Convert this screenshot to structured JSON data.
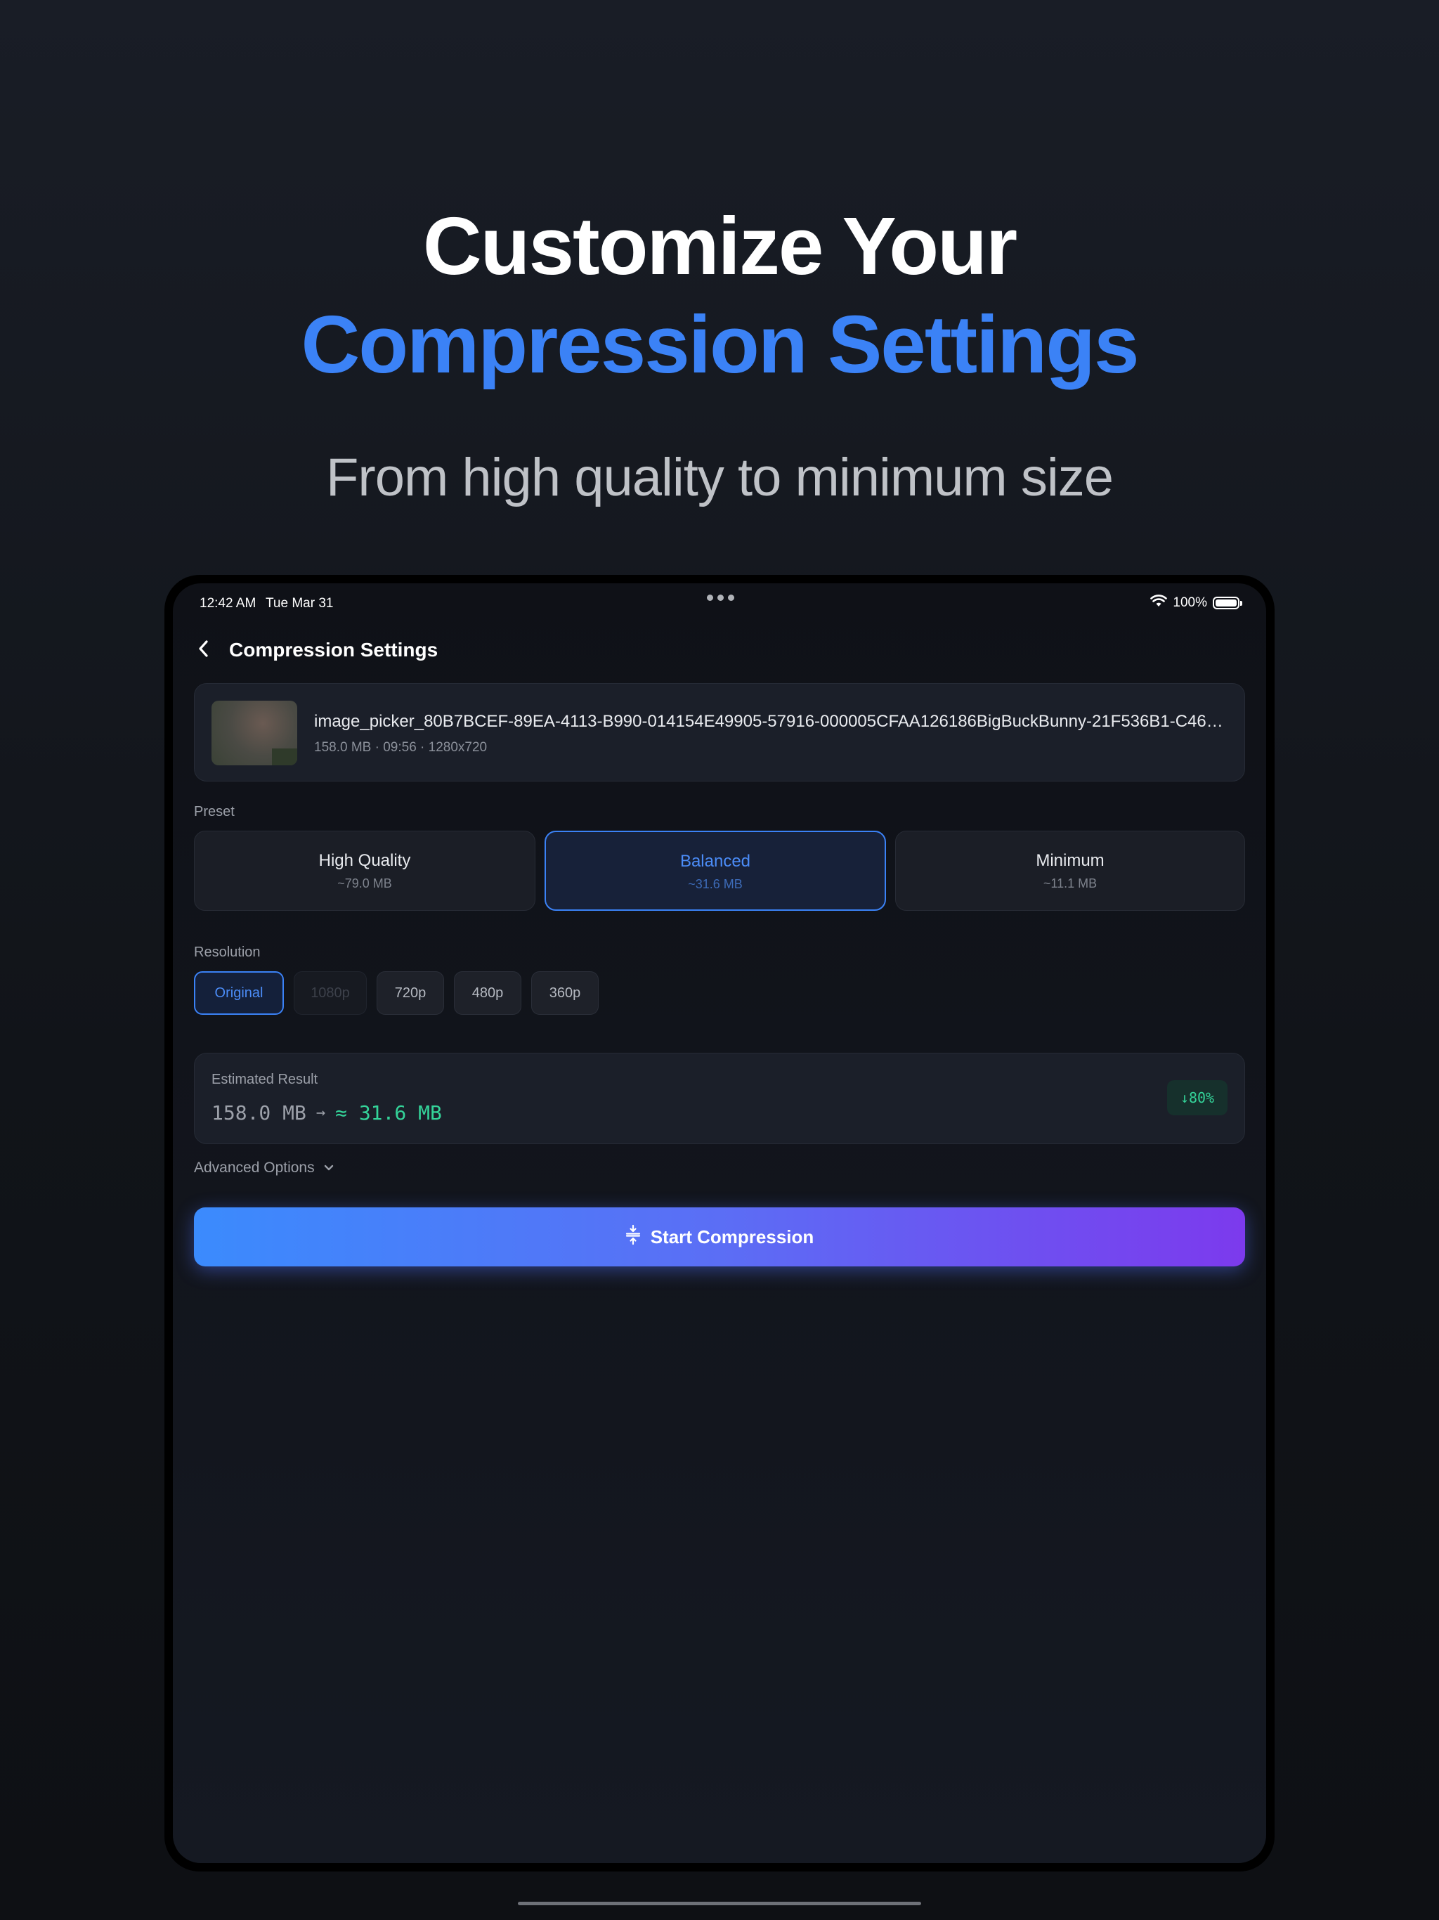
{
  "hero": {
    "line1": "Customize Your",
    "line2": "Compression Settings",
    "subtitle": "From high quality to minimum size"
  },
  "status_bar": {
    "time": "12:42 AM",
    "date": "Tue Mar 31",
    "battery": "100%"
  },
  "nav": {
    "title": "Compression Settings",
    "back_icon": "chevron-left-icon"
  },
  "file": {
    "name": "image_picker_80B7BCEF-89EA-4113-B990-014154E49905-57916-000005CFAA126186BigBuckBunny-21F536B1-C46D-4...",
    "meta": "158.0 MB · 09:56 · 1280x720"
  },
  "preset": {
    "label": "Preset",
    "options": [
      {
        "name": "High Quality",
        "size": "~79.0 MB",
        "selected": false
      },
      {
        "name": "Balanced",
        "size": "~31.6 MB",
        "selected": true
      },
      {
        "name": "Minimum",
        "size": "~11.1 MB",
        "selected": false
      }
    ]
  },
  "resolution": {
    "label": "Resolution",
    "options": [
      {
        "label": "Original",
        "state": "selected"
      },
      {
        "label": "1080p",
        "state": "disabled"
      },
      {
        "label": "720p",
        "state": "normal"
      },
      {
        "label": "480p",
        "state": "normal"
      },
      {
        "label": "360p",
        "state": "normal"
      }
    ]
  },
  "estimate": {
    "label": "Estimated Result",
    "from": "158.0 MB",
    "arrow": "→",
    "to": "≈ 31.6 MB",
    "badge": "↓80%"
  },
  "advanced": {
    "label": "Advanced Options",
    "icon": "chevron-down-icon"
  },
  "start_button": {
    "label": "Start Compression",
    "icon": "compress-icon"
  },
  "colors": {
    "accent": "#3b82f6",
    "success": "#34d399",
    "gradient_start": "#3b8bfd",
    "gradient_end": "#7c3aed"
  }
}
